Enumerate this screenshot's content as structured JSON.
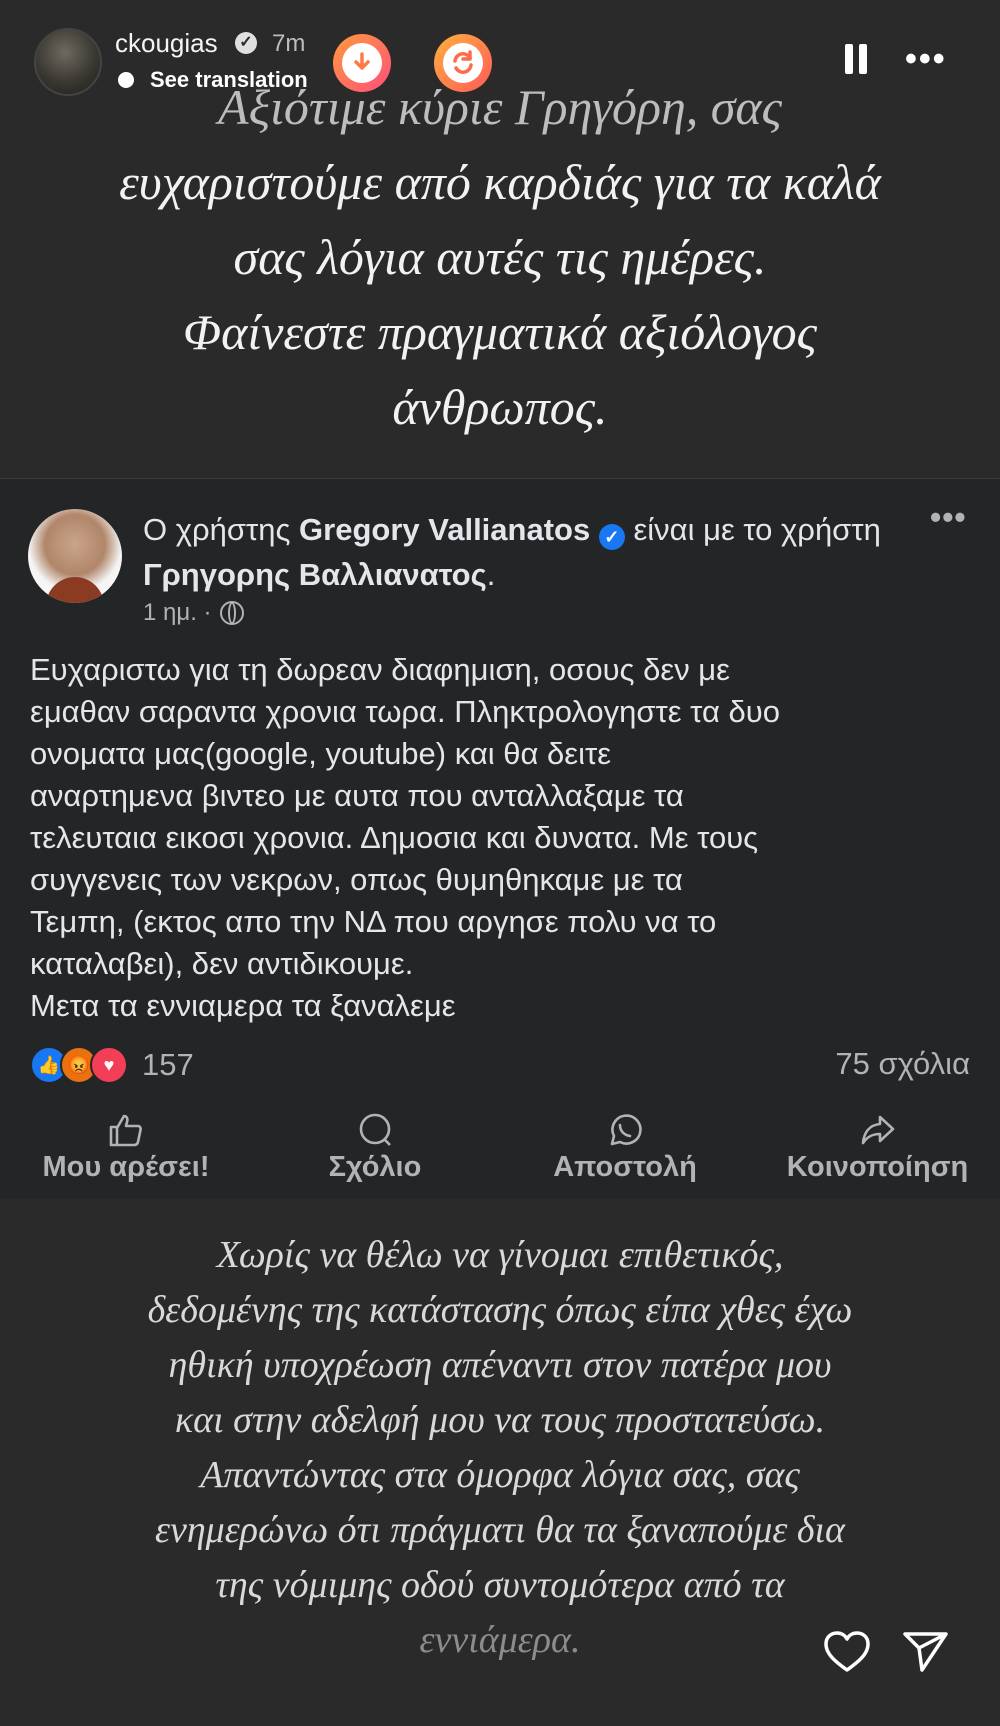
{
  "header": {
    "username": "ckougias",
    "time": "7m",
    "see_translation": "See translation"
  },
  "quote_top": {
    "first_line": "Αξιότιμε κύριε Γρηγόρη, σας",
    "rest": "ευχαριστούμε από καρδιάς για τα καλά\nσας λόγια αυτές τις ημέρες.\nΦαίνεστε πραγματικά αξιόλογος\nάνθρωπος."
  },
  "fb_post": {
    "title_prefix": "Ο χρήστης ",
    "author": "Gregory Vallianatos",
    "title_mid": " είναι με το χρήστη ",
    "tagged": "Γρηγορης Βαλλιανατος",
    "title_suffix": ".",
    "meta_time": "1 ημ. ·",
    "body": "Ευχαριστω για τη δωρεαν διαφημιση, οσους δεν με\nεμαθαν σαραντα χρονια τωρα. Πληκτρολογηστε τα δυο\nονοματα μας(google, youtube) και θα δειτε\nαναρτημενα βιντεο με αυτα που ανταλλαξαμε τα\nτελευταια εικοσι χρονια. Δημοσια και δυνατα. Με τους\nσυγγενεις των νεκρων, οπως θυμηθηκαμε με τα\nΤεμπη, (εκτος απο την ΝΔ που αργησε πολυ να το\nκαταλαβει), δεν αντιδικουμε.\nΜετα τα εννιαμερα τα ξαναλεμε",
    "reaction_count": "157",
    "comments": "75 σχόλια",
    "actions": {
      "like": "Μου αρέσει!",
      "comment": "Σχόλιο",
      "send": "Αποστολή",
      "share": "Κοινοποίηση"
    }
  },
  "quote_bottom": {
    "main": "Χωρίς να θέλω να γίνομαι επιθετικός,\nδεδομένης της κατάστασης όπως είπα χθες έχω\nηθική υποχρέωση απέναντι στον πατέρα μου\nκαι στην αδελφή μου να τους προστατεύσω.\nΑπαντώντας στα όμορφα λόγια σας, σας\nενημερώνω ότι πράγματι θα τα ξαναπούμε δια\nτης νόμιμης οδού συντομότερα από τα",
    "last": "εννιάμερα."
  },
  "icons": {
    "download": "download-icon",
    "refresh": "refresh-icon",
    "pause": "pause-icon",
    "more": "more-icon",
    "heart": "heart-icon",
    "send": "send-icon"
  }
}
